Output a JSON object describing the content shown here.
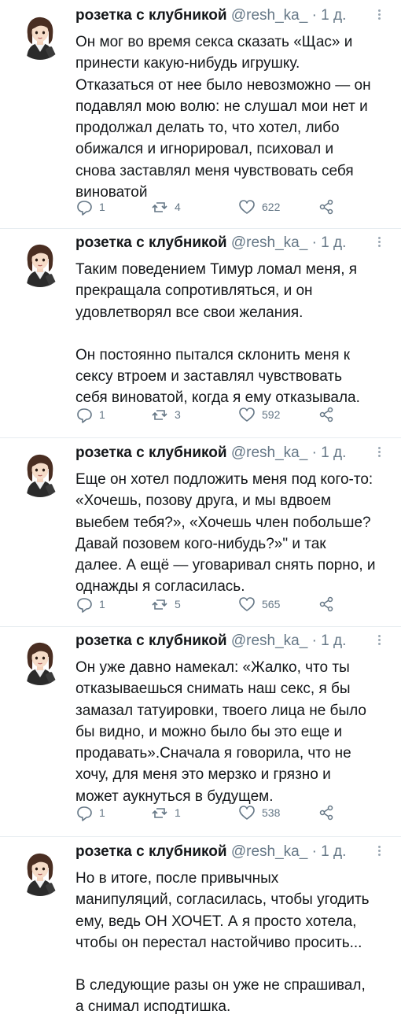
{
  "tweets": [
    {
      "author": "розетка с клубникой",
      "handle": "@resh_ka_",
      "separator": "·",
      "time": "1 д.",
      "lines": [
        "Он мог во время секса сказать «Щас» и",
        "принести какую-нибудь игрушку.",
        "Отказаться от нее было невозможно — он",
        "подавлял мою волю: не слушал мои нет и",
        "продолжал делать то, что хотел, либо",
        "обижался и игнорировал, психовал  и",
        "снова заставлял меня чувствовать себя",
        "виноватой"
      ],
      "replies": "1",
      "retweets": "4",
      "likes": "622"
    },
    {
      "author": "розетка с клубникой",
      "handle": "@resh_ka_",
      "separator": "·",
      "time": "1 д.",
      "lines": [
        "Таким поведением Тимур ломал меня, я",
        "прекращала сопротивляться, и он",
        "удовлетворял все свои желания.",
        "",
        "Он постоянно пытался склонить меня к",
        "сексу втроем и заставлял чувствовать",
        "себя виноватой, когда я ему отказывала."
      ],
      "replies": "1",
      "retweets": "3",
      "likes": "592"
    },
    {
      "author": "розетка с клубникой",
      "handle": "@resh_ka_",
      "separator": "·",
      "time": "1 д.",
      "lines": [
        "Еще он хотел подложить меня под кого-то:",
        "«Хочешь, позову друга, и мы вдвоем",
        "выебем тебя?», «Хочешь член побольше?",
        "Давай позовем кого-нибудь?»\" и так",
        "далее. А ещё — уговаривал снять порно, и",
        "однажды я согласилась."
      ],
      "replies": "1",
      "retweets": "5",
      "likes": "565"
    },
    {
      "author": "розетка с клубникой",
      "handle": "@resh_ka_",
      "separator": "·",
      "time": "1 д.",
      "lines": [
        "Он уже давно намекал: «Жалко, что ты",
        "отказываешься снимать наш секс, я бы",
        "замазал татуировки, твоего лица не было",
        "бы видно, и можно было бы это еще и",
        "продавать».Сначала я говорила, что не",
        "хочу, для меня это мерзко и грязно и",
        "может аукнуться в будущем."
      ],
      "replies": "1",
      "retweets": "1",
      "likes": "538"
    },
    {
      "author": "розетка с клубникой",
      "handle": "@resh_ka_",
      "separator": "·",
      "time": "1 д.",
      "lines": [
        "Но в итоге, после привычных",
        "манипуляций, согласилась, чтобы угодить",
        "ему, ведь ОН ХОЧЕТ. А я просто хотела,",
        "чтобы он перестал настойчиво просить...",
        "",
        "В следующие разы он уже не спрашивал,",
        "а снимал исподтишка."
      ]
    }
  ],
  "icons": {
    "reply": "reply-icon",
    "retweet": "retweet-icon",
    "like": "heart-icon",
    "share": "share-icon",
    "more": "more-vertical-icon"
  },
  "colors": {
    "text": "#14171a",
    "secondary": "#657786",
    "divider": "#e6ecf0"
  }
}
